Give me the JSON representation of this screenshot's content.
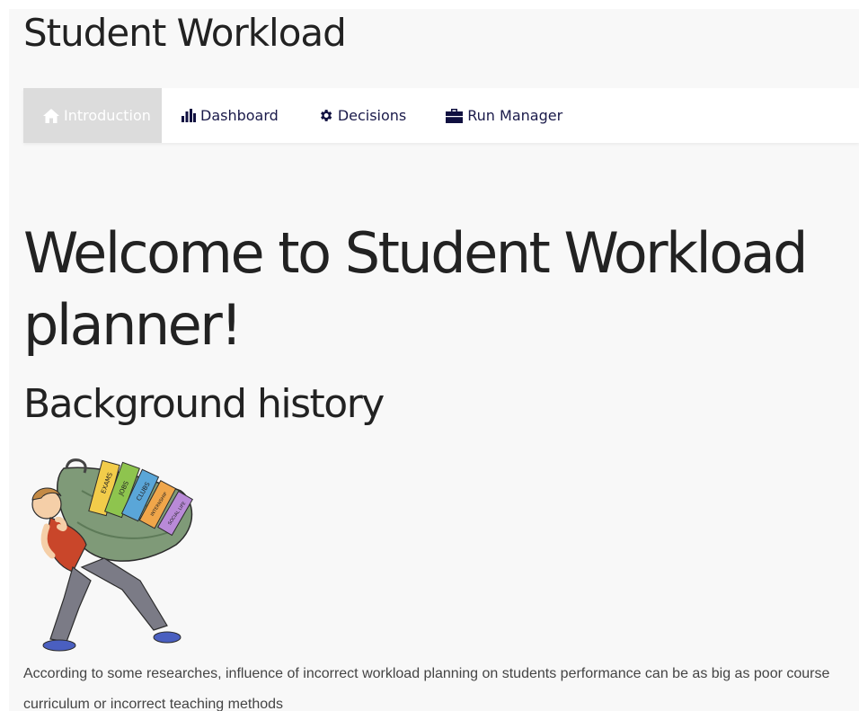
{
  "app": {
    "title": "Student Workload"
  },
  "nav": {
    "items": [
      {
        "label": "Introduction",
        "icon": "home-icon",
        "active": true
      },
      {
        "label": "Dashboard",
        "icon": "bar-chart-icon",
        "active": false
      },
      {
        "label": "Decisions",
        "icon": "gear-icon",
        "active": false
      },
      {
        "label": "Run Manager",
        "icon": "briefcase-icon",
        "active": false
      }
    ]
  },
  "main": {
    "heading": "Welcome to Student Workload planner!",
    "section_title": "Background history",
    "illustration": {
      "book_labels": [
        "EXAMS",
        "JOBS",
        "CLUBS",
        "INTERNSHIP",
        "SOCIAL LIFE"
      ]
    },
    "paragraph": "According to some researches, influence of incorrect workload planning on students performance can be as big as poor course curriculum or incorrect teaching methods"
  },
  "colors": {
    "page_bg": "#f8f8f8",
    "nav_bg": "#ffffff",
    "nav_active_bg": "#dcdcdc",
    "nav_text": "#1a1a4a",
    "heading_text": "#222222",
    "body_text": "#444444"
  }
}
